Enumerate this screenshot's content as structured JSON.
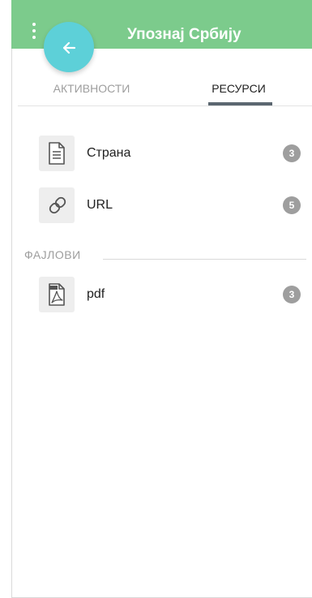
{
  "header": {
    "title": "Упознај Србију",
    "menu_icon": "more-vertical-icon",
    "back_icon": "arrow-left-icon",
    "bar_color": "#7ccb8c",
    "fab_color": "#5dd0d8"
  },
  "tabs": [
    {
      "label": "АКТИВНОСТИ",
      "active": false
    },
    {
      "label": "РЕСУРСИ",
      "active": true
    }
  ],
  "resources": [
    {
      "label": "Страна",
      "count": "3",
      "icon": "document-icon"
    },
    {
      "label": "URL",
      "count": "5",
      "icon": "link-icon"
    }
  ],
  "files": {
    "heading": "ФАЈЛОВИ",
    "items": [
      {
        "label": "pdf",
        "count": "3",
        "icon": "pdf-file-icon"
      }
    ]
  }
}
